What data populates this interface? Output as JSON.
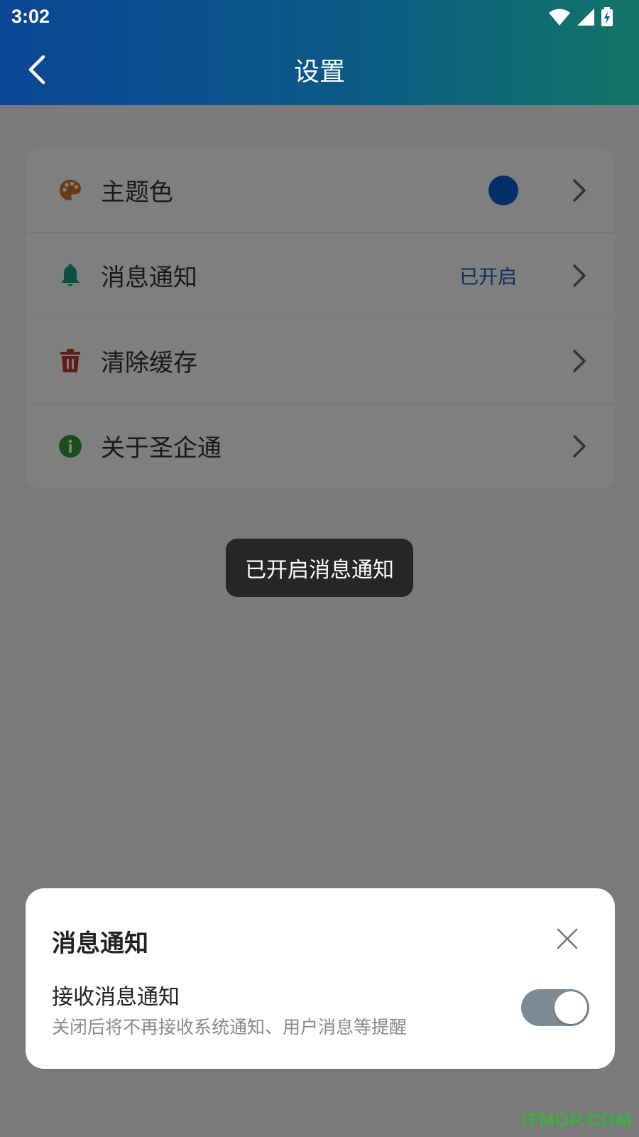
{
  "status_bar": {
    "time": "3:02",
    "icons": [
      "wifi-icon",
      "cell-signal-icon",
      "battery-charging-icon"
    ]
  },
  "header": {
    "title": "设置",
    "back_icon": "chevron-left-icon"
  },
  "settings": {
    "items": [
      {
        "label": "主题色",
        "icon": "palette-icon",
        "icon_color": "#d9732b",
        "swatch_color": "#0a5ad0"
      },
      {
        "label": "消息通知",
        "icon": "bell-icon",
        "icon_color": "#1a9c8a",
        "value": "已开启",
        "value_color": "#1360b8"
      },
      {
        "label": "清除缓存",
        "icon": "trash-icon",
        "icon_color": "#c0392b"
      },
      {
        "label": "关于圣企通",
        "icon": "info-icon",
        "icon_color": "#2e9b3e"
      }
    ]
  },
  "toast": {
    "text": "已开启消息通知"
  },
  "sheet": {
    "title": "消息通知",
    "option_label": "接收消息通知",
    "option_description": "关闭后将不再接收系统通知、用户消息等提醒",
    "toggle_on": true,
    "toggle_color": "#7b8c98"
  },
  "watermark": "ITMOP.COM"
}
